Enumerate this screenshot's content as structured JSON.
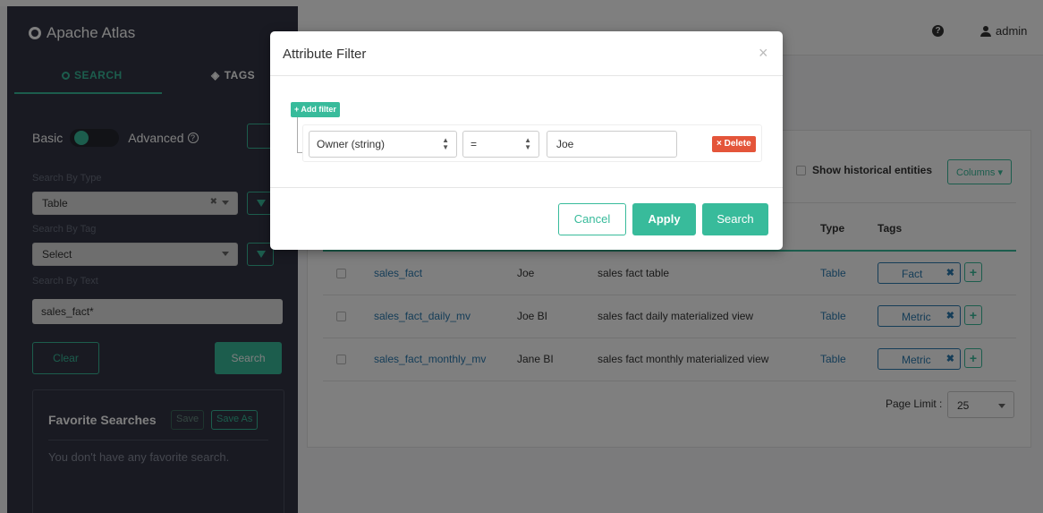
{
  "app": {
    "title": "Apache Atlas"
  },
  "sidebar": {
    "tabs": [
      {
        "label": "SEARCH"
      },
      {
        "label": "TAGS"
      }
    ],
    "toggle": {
      "basic": "Basic",
      "advanced": "Advanced"
    },
    "search_by_type": {
      "label": "Search By Type",
      "value": "Table"
    },
    "search_by_tag": {
      "label": "Search By Tag",
      "value": "Select"
    },
    "search_by_text": {
      "label": "Search By Text",
      "value": "sales_fact*"
    },
    "clear_label": "Clear",
    "search_label": "Search",
    "favorites": {
      "title": "Favorite Searches",
      "save_label": "Save",
      "save_as_label": "Save As",
      "empty_text": "You don't have any favorite search."
    }
  },
  "header": {
    "help": "?",
    "user": "admin"
  },
  "results": {
    "show_historical": "Show historical entities",
    "columns_label": "Columns",
    "columns": {
      "type": "Type",
      "tags": "Tags"
    },
    "rows": [
      {
        "name": "sales_fact",
        "owner": "Joe",
        "description": "sales fact table",
        "type": "Table",
        "tag": "Fact"
      },
      {
        "name": "sales_fact_daily_mv",
        "owner": "Joe BI",
        "description": "sales fact daily materialized view",
        "type": "Table",
        "tag": "Metric"
      },
      {
        "name": "sales_fact_monthly_mv",
        "owner": "Jane BI",
        "description": "sales fact monthly materialized view",
        "type": "Table",
        "tag": "Metric"
      }
    ],
    "page_limit_label": "Page Limit :",
    "page_limit_value": "25"
  },
  "modal": {
    "title": "Attribute Filter",
    "close": "×",
    "add_filter_label": "+ Add filter",
    "rule": {
      "attribute": "Owner (string)",
      "operator": "=",
      "value": "Joe",
      "delete_label": "× Delete"
    },
    "cancel_label": "Cancel",
    "apply_label": "Apply",
    "search_label": "Search"
  },
  "colors": {
    "accent": "#38bb9b",
    "sidebar_bg": "#323544",
    "link": "#2a7ab0",
    "danger": "#e4553a"
  }
}
